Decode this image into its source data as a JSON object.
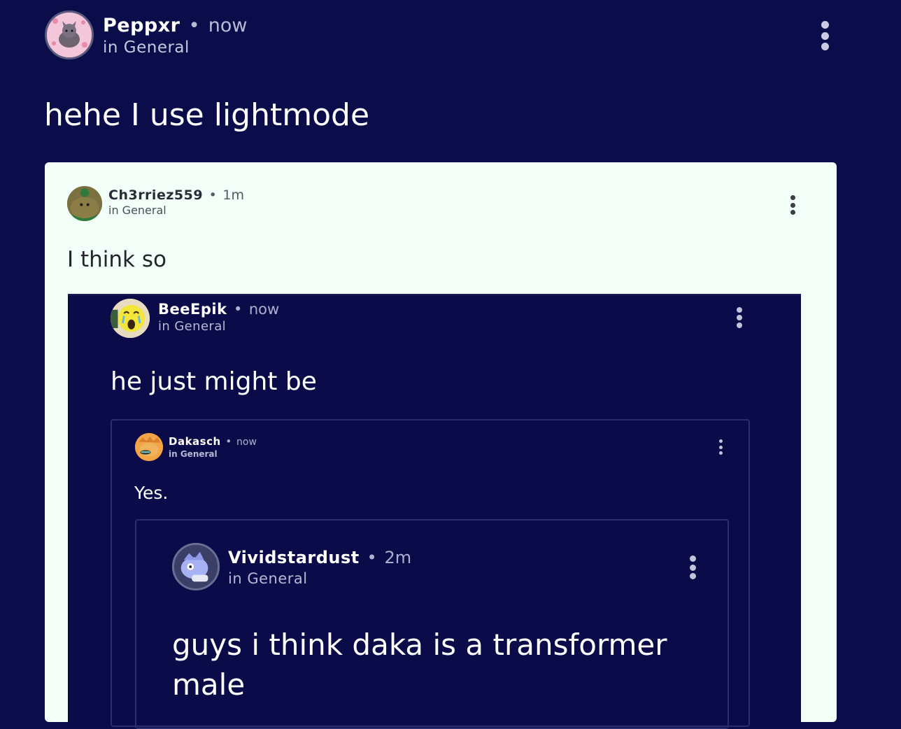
{
  "outer_post": {
    "author": "Peppxr",
    "separator": "•",
    "time": "now",
    "channel": "in General",
    "text": "hehe I use lightmode",
    "avatar_icon": "pink-cat-avatar-icon",
    "menu_icon": "kebab-menu-icon"
  },
  "quoted_light": {
    "author": "Ch3rriez559",
    "separator": "•",
    "time": "1m",
    "channel": "in General",
    "text": "I think so",
    "avatar_icon": "green-creature-avatar-icon",
    "menu_icon": "kebab-menu-icon"
  },
  "quoted_bee": {
    "author": "BeeEpik",
    "separator": "•",
    "time": "now",
    "channel": "in General",
    "text": "he just might be",
    "avatar_icon": "crying-face-avatar-icon",
    "menu_icon": "kebab-menu-icon"
  },
  "quoted_dakasch": {
    "author": "Dakasch",
    "separator": "•",
    "time": "now",
    "channel": "in General",
    "text": "Yes.",
    "avatar_icon": "orange-creature-avatar-icon",
    "menu_icon": "kebab-menu-icon"
  },
  "quoted_vivid": {
    "author": "Vividstardust",
    "separator": "•",
    "time": "2m",
    "channel": "in General",
    "text": "guys i think daka is a transformer male",
    "avatar_icon": "blue-character-avatar-icon",
    "menu_icon": "kebab-menu-icon"
  },
  "colors": {
    "page_background": "#0b0d4a",
    "light_card_background": "#f2fff8",
    "dark_card_background": "#0b0b49",
    "border": "#2a2d6e"
  }
}
